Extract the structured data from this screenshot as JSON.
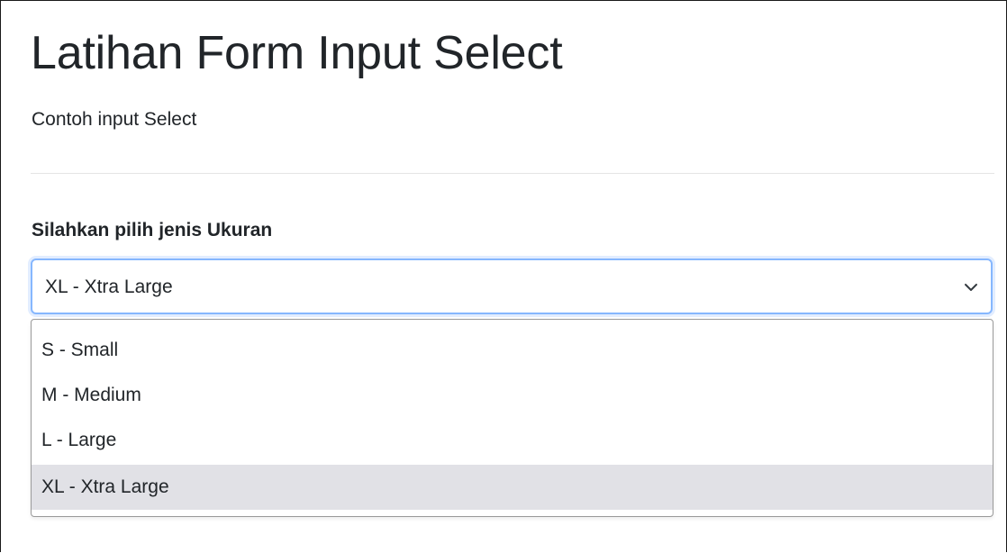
{
  "page": {
    "title": "Latihan Form Input Select",
    "subtitle": "Contoh input Select"
  },
  "form": {
    "label": "Silahkan pilih jenis Ukuran",
    "selected_value": "XL - Xtra Large",
    "options": [
      {
        "label": "S - Small",
        "selected": false
      },
      {
        "label": "M - Medium",
        "selected": false
      },
      {
        "label": "L - Large",
        "selected": false
      },
      {
        "label": "XL - Xtra Large",
        "selected": true
      }
    ]
  },
  "icons": {
    "select_chevron": "chevron-down-icon"
  },
  "colors": {
    "focus_border": "#86b7fe",
    "selected_option_bg": "#e1e1e6",
    "text": "#212529"
  }
}
